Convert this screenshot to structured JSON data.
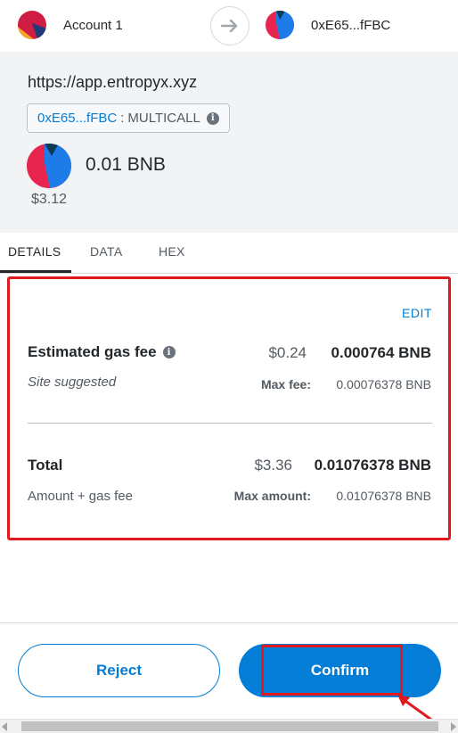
{
  "header": {
    "from_account": "Account 1",
    "to_address": "0xE65...fFBC",
    "arrow_icon": "arrow-right-icon"
  },
  "origin": {
    "site_url": "https://app.entropyx.xyz",
    "contract_address": "0xE65...fFBC",
    "separator": ":",
    "method": "MULTICALL",
    "info_icon": "info-icon",
    "value_amount": "0.01 BNB",
    "value_fiat": "$3.12"
  },
  "tabs": [
    {
      "label": "DETAILS",
      "active": true
    },
    {
      "label": "DATA",
      "active": false
    },
    {
      "label": "HEX",
      "active": false
    }
  ],
  "details": {
    "edit_label": "EDIT",
    "gas_title": "Estimated gas fee",
    "gas_fiat": "$0.24",
    "gas_native": "0.000764 BNB",
    "gas_source": "Site suggested",
    "max_fee_label": "Max fee:",
    "max_fee_value": "0.00076378 BNB",
    "total_title": "Total",
    "total_fiat": "$3.36",
    "total_native": "0.01076378 BNB",
    "total_subtitle": "Amount + gas fee",
    "max_amount_label": "Max amount:",
    "max_amount_value": "0.01076378 BNB"
  },
  "footer": {
    "reject_label": "Reject",
    "confirm_label": "Confirm"
  },
  "colors": {
    "accent": "#037dd6",
    "annotation": "#e0191f",
    "header_bg": "#f2f3f4"
  }
}
